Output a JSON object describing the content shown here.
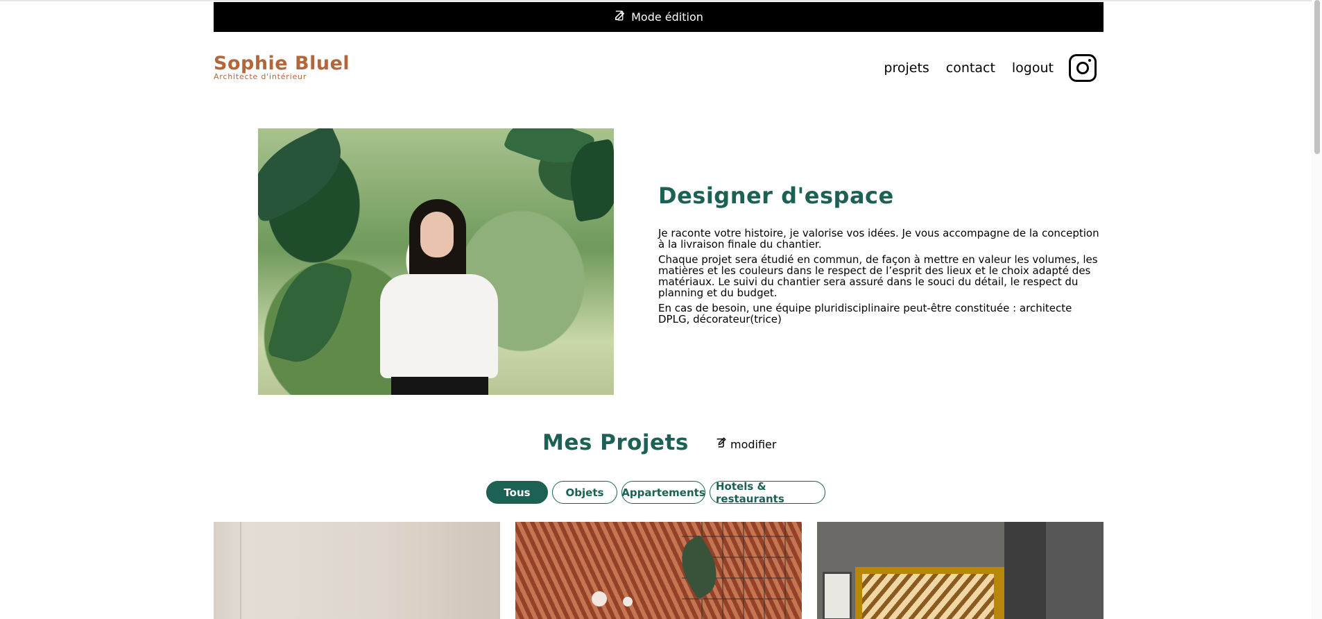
{
  "edit_bar": {
    "label": "Mode édition"
  },
  "header": {
    "logo_name": "Sophie Bluel",
    "logo_subtitle": "Architecte d'intérieur",
    "nav": [
      "projets",
      "contact",
      "logout"
    ],
    "instagram_icon": "instagram-icon"
  },
  "intro": {
    "title": "Designer d'espace",
    "paragraphs": [
      "Je raconte votre histoire, je valorise vos idées. Je vous accompagne de la conception à la livraison finale du chantier.",
      "Chaque projet sera étudié en commun, de façon à mettre en valeur les volumes, les matières et les couleurs dans le respect de l’esprit des lieux et le choix adapté des matériaux. Le suivi du chantier sera assuré dans le souci du détail, le respect du planning et du budget.",
      "En cas de besoin, une équipe pluridisciplinaire peut-être constituée : architecte DPLG, décorateur(trice)"
    ]
  },
  "projects": {
    "title": "Mes Projets",
    "modify_label": "modifier",
    "filters": [
      "Tous",
      "Objets",
      "Appartements",
      "Hotels & restaurants"
    ],
    "active_filter": "Tous"
  },
  "colors": {
    "primary": "#1D6154",
    "logo": "#B1663C",
    "edit_bar": "#000000"
  }
}
